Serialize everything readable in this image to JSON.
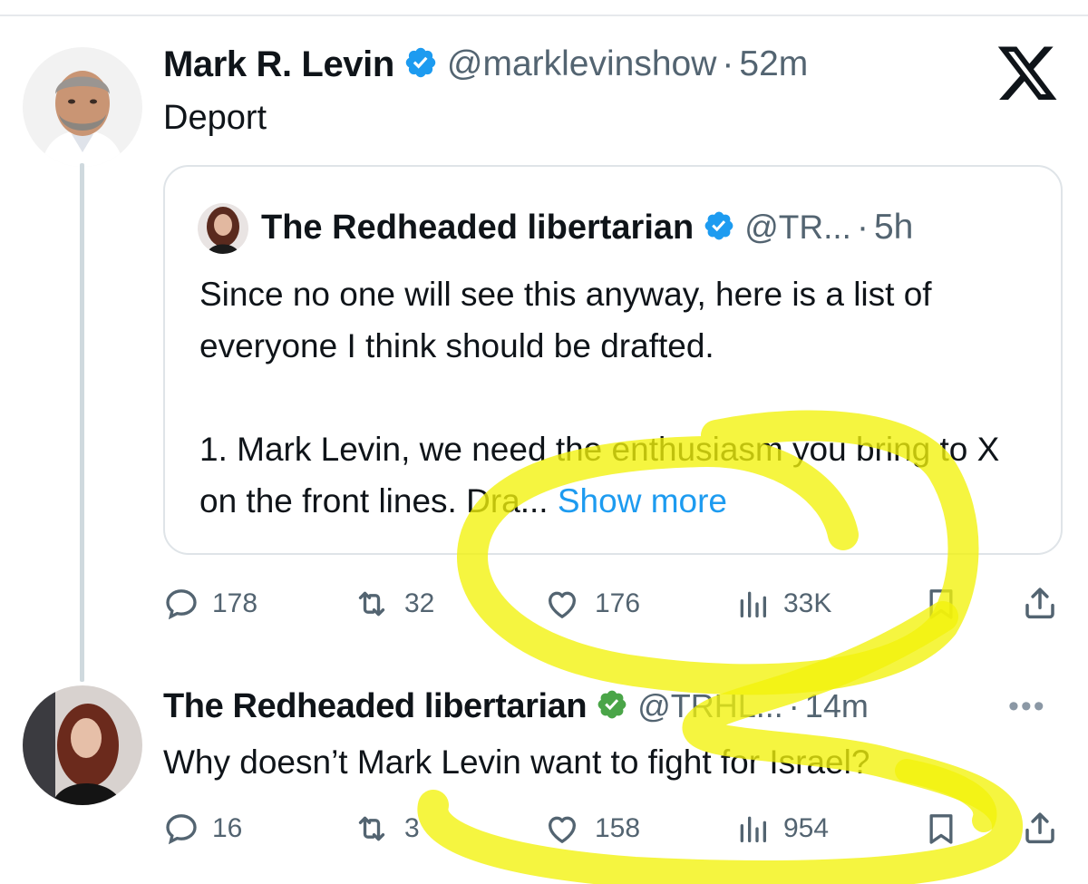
{
  "tweet1": {
    "name": "Mark R. Levin",
    "handle": "@marklevinshow",
    "separator": "·",
    "time": "52m",
    "text": "Deport",
    "verified_color": "#1d9bf0",
    "actions": {
      "replies": "178",
      "reposts": "32",
      "likes": "176",
      "views": "33K"
    }
  },
  "quote": {
    "name": "The Redheaded libertarian",
    "handle": "@TR...",
    "separator": "·",
    "time": "5h",
    "paragraph1": "Since no one will see this anyway, here is a list of everyone I think should be drafted.",
    "paragraph2": "1. Mark Levin, we need the enthusiasm you bring to X on the front lines. Dra...",
    "show_more": "Show more"
  },
  "tweet2": {
    "name": "The Redheaded libertarian",
    "handle": "@TRHL...",
    "separator": "·",
    "time": "14m",
    "text": "Why doesn’t Mark Levin want to fight for Israel?",
    "verified_color": "#4aa548",
    "more": "•••",
    "actions": {
      "replies": "16",
      "reposts": "3",
      "likes": "158",
      "views": "954"
    }
  },
  "icons": {
    "logo": "x-logo-icon",
    "verified": "verified-badge-icon",
    "reply": "reply-icon",
    "repost": "repost-icon",
    "like": "heart-icon",
    "views": "views-icon",
    "bookmark": "bookmark-icon",
    "share": "share-icon"
  },
  "colors": {
    "accent": "#1d9bf0",
    "highlighter": "#f2f20a",
    "muted": "#536471"
  }
}
